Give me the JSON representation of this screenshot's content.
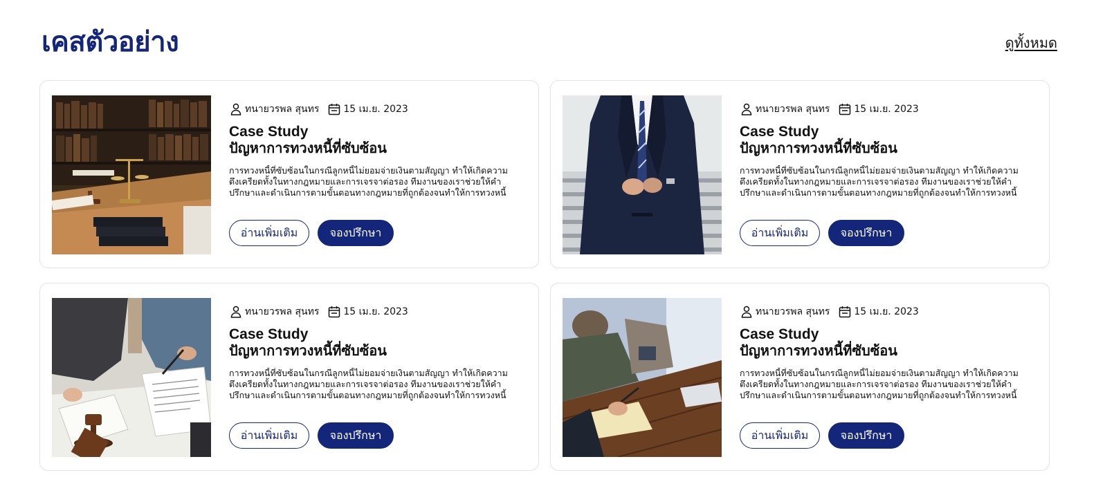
{
  "section": {
    "title": "เคสตัวอย่าง",
    "view_all_label": "ดูทั้งหมด"
  },
  "cards": [
    {
      "author": "ทนายวรพล สุนทร",
      "date": "15 เม.ย. 2023",
      "title_en": "Case Study",
      "title_th": "ปัญหาการทวงหนี้ที่ซับซ้อน",
      "description": "การทวงหนี้ที่ซับซ้อนในกรณีลูกหนี้ไม่ยอมจ่ายเงินตามสัญญา ทำให้เกิดความตึงเครียดทั้งในทางกฎหมายและการเจรจาต่อรอง ทีมงานของเราช่วยให้คำปรึกษาและดำเนินการตามขั้นตอนทางกฎหมายที่ถูกต้องจนทำให้การทวงหนี้สำเร็จ",
      "read_more_label": "อ่านเพิ่มเติม",
      "book_label": "จองปรึกษา",
      "image": "law-library-desk-scales"
    },
    {
      "author": "ทนายวรพล สุนทร",
      "date": "15 เม.ย. 2023",
      "title_en": "Case Study",
      "title_th": "ปัญหาการทวงหนี้ที่ซับซ้อน",
      "description": "การทวงหนี้ที่ซับซ้อนในกรณีลูกหนี้ไม่ยอมจ่ายเงินตามสัญญา ทำให้เกิดความตึงเครียดทั้งในทางกฎหมายและการเจรจาต่อรอง ทีมงานของเราช่วยให้คำปรึกษาและดำเนินการตามขั้นตอนทางกฎหมายที่ถูกต้องจนทำให้การทวงหนี้สำเร็จ",
      "read_more_label": "อ่านเพิ่มเติม",
      "book_label": "จองปรึกษา",
      "image": "businessman-suit"
    },
    {
      "author": "ทนายวรพล สุนทร",
      "date": "15 เม.ย. 2023",
      "title_en": "Case Study",
      "title_th": "ปัญหาการทวงหนี้ที่ซับซ้อน",
      "description": "การทวงหนี้ที่ซับซ้อนในกรณีลูกหนี้ไม่ยอมจ่ายเงินตามสัญญา ทำให้เกิดความตึงเครียดทั้งในทางกฎหมายและการเจรจาต่อรอง ทีมงานของเราช่วยให้คำปรึกษาและดำเนินการตามขั้นตอนทางกฎหมายที่ถูกต้องจนทำให้การทวงหนี้สำเร็จ",
      "read_more_label": "อ่านเพิ่มเติม",
      "book_label": "จองปรึกษา",
      "image": "signing-document-gavel"
    },
    {
      "author": "ทนายวรพล สุนทร",
      "date": "15 เม.ย. 2023",
      "title_en": "Case Study",
      "title_th": "ปัญหาการทวงหนี้ที่ซับซ้อน",
      "description": "การทวงหนี้ที่ซับซ้อนในกรณีลูกหนี้ไม่ยอมจ่ายเงินตามสัญญา ทำให้เกิดความตึงเครียดทั้งในทางกฎหมายและการเจรจาต่อรอง ทีมงานของเราช่วยให้คำปรึกษาและดำเนินการตามขั้นตอนทางกฎหมายที่ถูกต้องจนทำให้การทวงหนี้สำเร็จ",
      "read_more_label": "อ่านเพิ่มเติม",
      "book_label": "จองปรึกษา",
      "image": "meeting-table-writing"
    }
  ],
  "icons": {
    "author": "user-icon",
    "date": "calendar-icon"
  },
  "colors": {
    "accent": "#14267a",
    "card_border": "#e3e3e3",
    "text": "#111111"
  }
}
